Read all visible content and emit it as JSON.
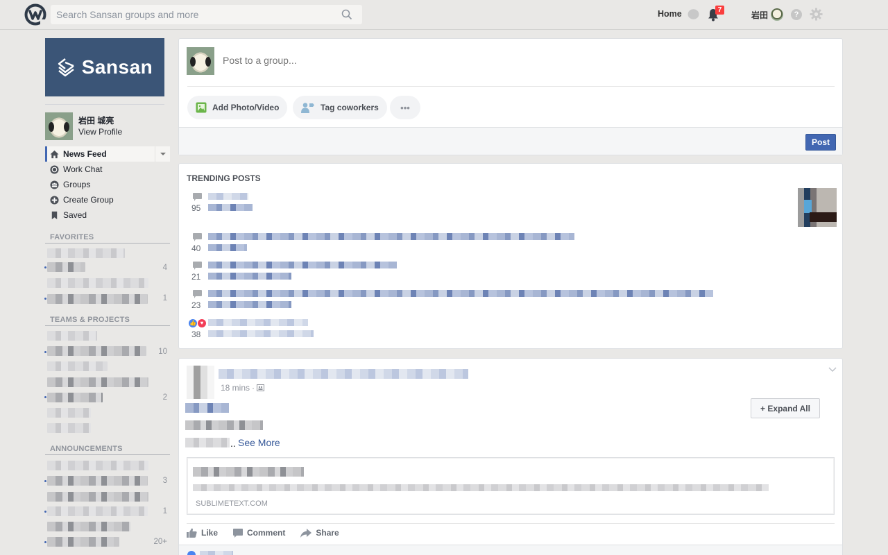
{
  "topbar": {
    "logo": "workplace-logo",
    "search_placeholder": "Search Sansan groups and more",
    "home_label": "Home",
    "notification_count": "7",
    "user_short_name": "岩田",
    "help_glyph": "?"
  },
  "sidebar": {
    "brand_name": "Sansan",
    "profile": {
      "name": "岩田 城亮",
      "link_label": "View Profile"
    },
    "nav": [
      {
        "label": "News Feed",
        "icon": "home-icon",
        "active": true
      },
      {
        "label": "Work Chat",
        "icon": "chat-icon"
      },
      {
        "label": "Groups",
        "icon": "groups-icon"
      },
      {
        "label": "Create Group",
        "icon": "plus-circle-icon"
      },
      {
        "label": "Saved",
        "icon": "bookmark-icon"
      }
    ],
    "sections": {
      "favorites": {
        "title": "FAVORITES",
        "counts": [
          "4",
          "1"
        ]
      },
      "teams": {
        "title": "TEAMS & PROJECTS",
        "counts": [
          "10",
          "2"
        ]
      },
      "announcements": {
        "title": "ANNOUNCEMENTS",
        "counts": [
          "3",
          "1",
          "20+"
        ]
      }
    }
  },
  "composer": {
    "placeholder": "Post to a group...",
    "add_photo_label": "Add Photo/Video",
    "tag_label": "Tag coworkers",
    "more_label": "•••",
    "post_label": "Post"
  },
  "trending": {
    "title": "TRENDING POSTS",
    "items": [
      {
        "count": "95",
        "type": "comments"
      },
      {
        "count": "40",
        "type": "comments"
      },
      {
        "count": "21",
        "type": "comments"
      },
      {
        "count": "23",
        "type": "comments"
      },
      {
        "count": "38",
        "type": "reactions"
      }
    ]
  },
  "feed_post": {
    "time": "18 mins",
    "meta_separator": "·",
    "expand_label": "+ Expand All",
    "ellipsis": "..",
    "see_more_label": "See More",
    "link_domain": "SUBLIMETEXT.COM",
    "actions": {
      "like": "Like",
      "comment": "Comment",
      "share": "Share"
    }
  },
  "colors": {
    "accent": "#4267b2",
    "brand_bg": "#3b5577",
    "badge": "#fa3e3e",
    "link": "#365899"
  }
}
